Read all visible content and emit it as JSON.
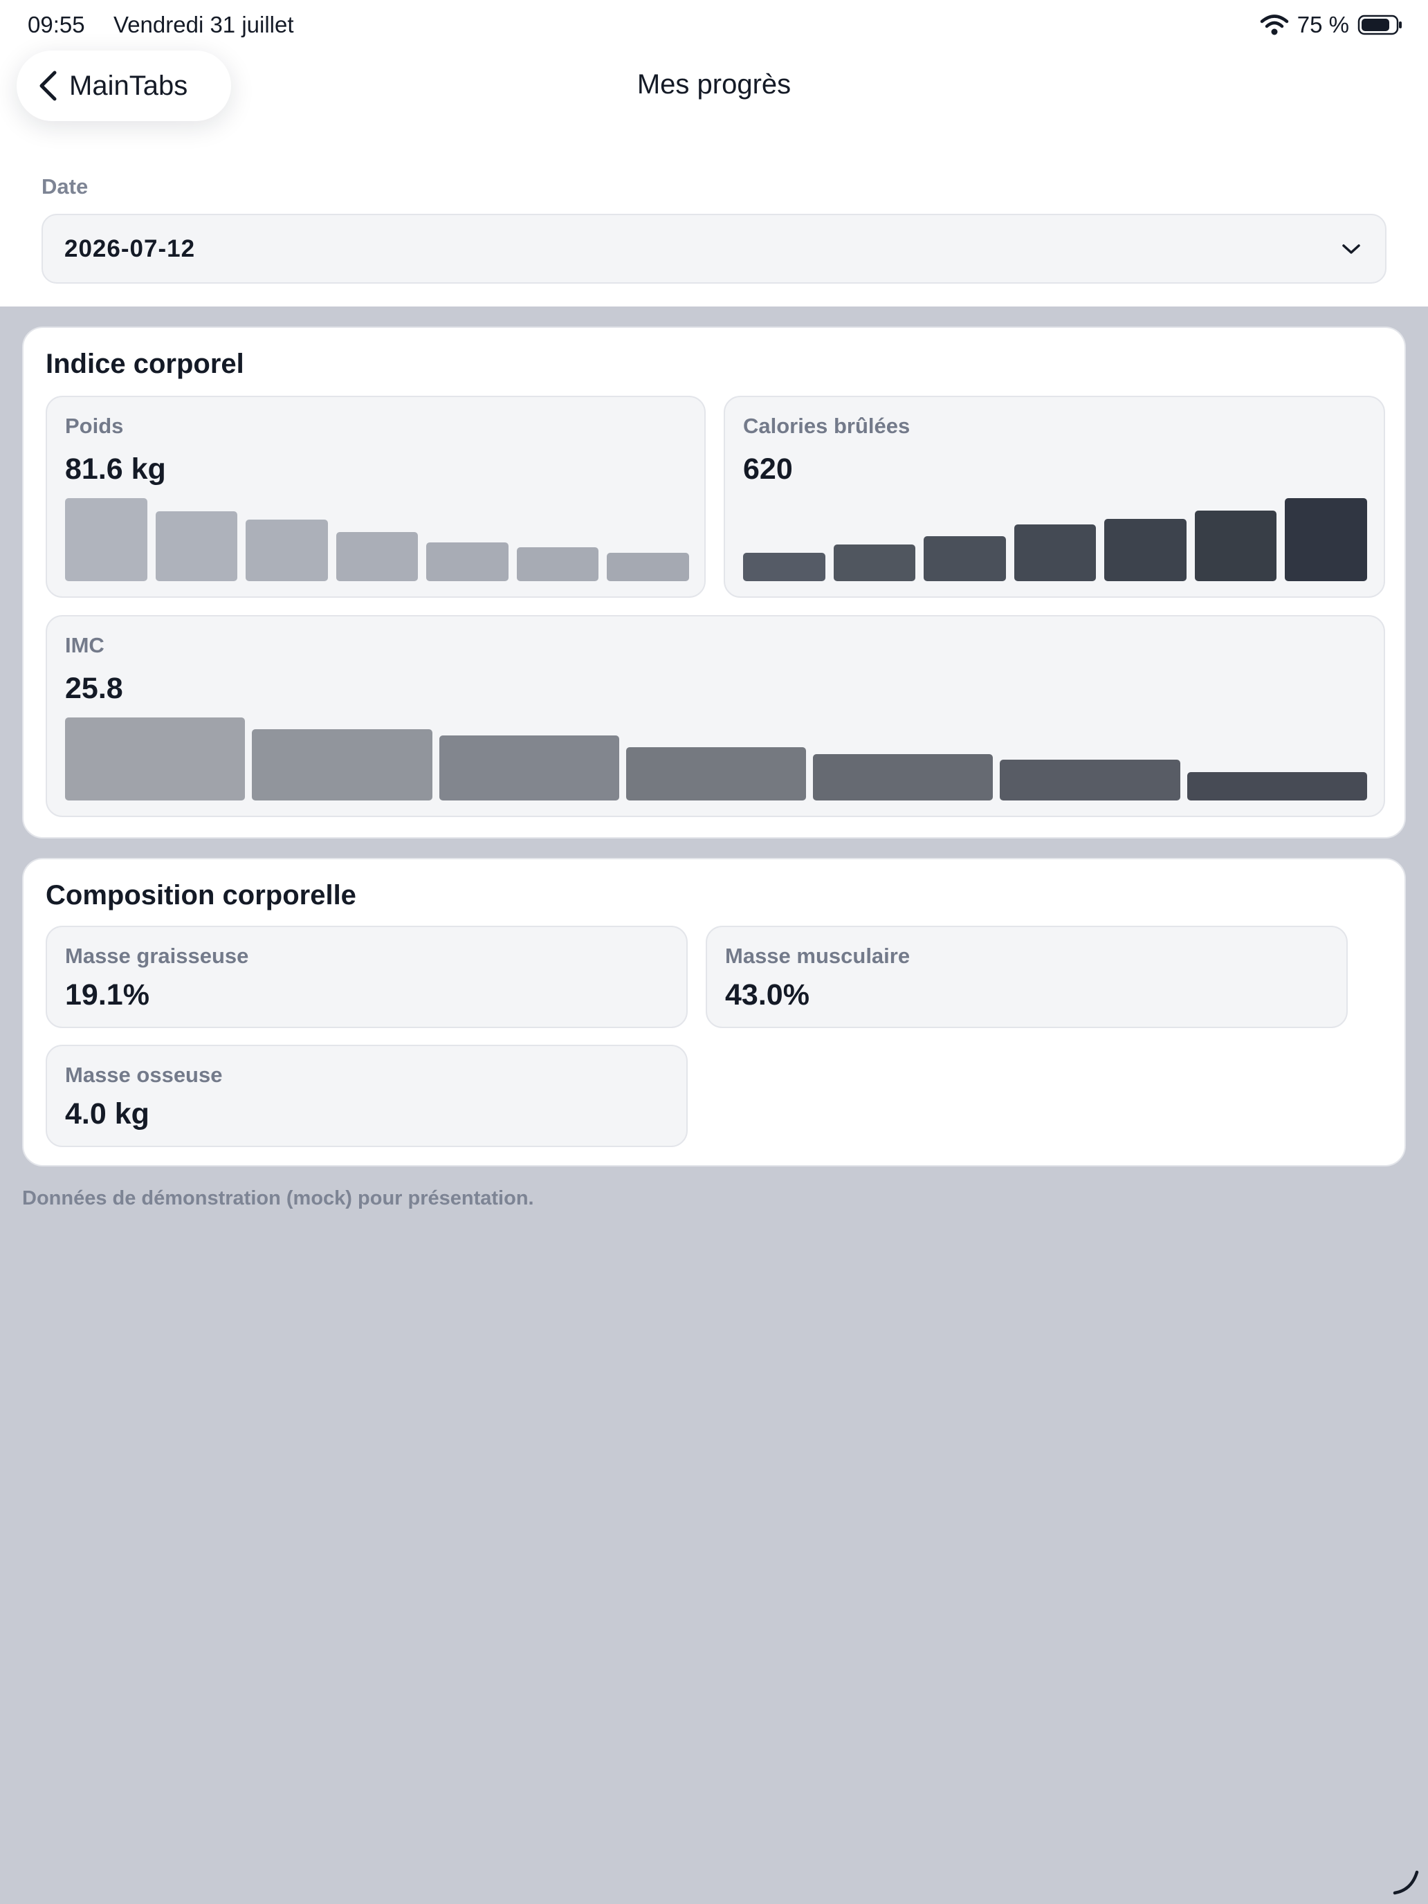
{
  "status": {
    "time": "09:55",
    "date": "Vendredi 31 juillet",
    "battery": "75 %"
  },
  "nav": {
    "back_label": "MainTabs",
    "title": "Mes progrès"
  },
  "date_filter": {
    "label": "Date",
    "value": "2026-07-12"
  },
  "indice": {
    "title": "Indice corporel",
    "poids": {
      "label": "Poids",
      "value": "81.6 kg",
      "bars": [
        100,
        84,
        74,
        59,
        47,
        41,
        34
      ],
      "colors": [
        "#b0b4bd",
        "#aeb2bb",
        "#acb0b9",
        "#aaaeb7",
        "#a8acb5",
        "#a7abb4",
        "#a5a9b2"
      ]
    },
    "calories": {
      "label": "Calories brûlées",
      "value": "620",
      "bars": [
        34,
        44,
        54,
        68,
        75,
        85,
        100
      ],
      "colors": [
        "#555b66",
        "#50565f",
        "#4a505a",
        "#444a54",
        "#3d434d",
        "#383e47",
        "#303642"
      ]
    },
    "imc": {
      "label": "IMC",
      "value": "25.8",
      "bars": [
        100,
        86,
        78,
        64,
        56,
        49,
        34
      ],
      "colors": [
        "#a0a3aa",
        "#91959c",
        "#82868e",
        "#757980",
        "#666a72",
        "#585c65",
        "#474b55"
      ]
    }
  },
  "composition": {
    "title": "Composition corporelle",
    "items": [
      {
        "label": "Masse graisseuse",
        "value": "19.1%"
      },
      {
        "label": "Masse musculaire",
        "value": "43.0%"
      },
      {
        "label": "Masse osseuse",
        "value": "4.0 kg"
      }
    ]
  },
  "footnote": "Données de démonstration (mock) pour présentation.",
  "icons": {
    "back": "chevron-left-icon",
    "select": "chevron-down-icon",
    "wifi": "wifi-icon",
    "battery": "battery-icon"
  }
}
